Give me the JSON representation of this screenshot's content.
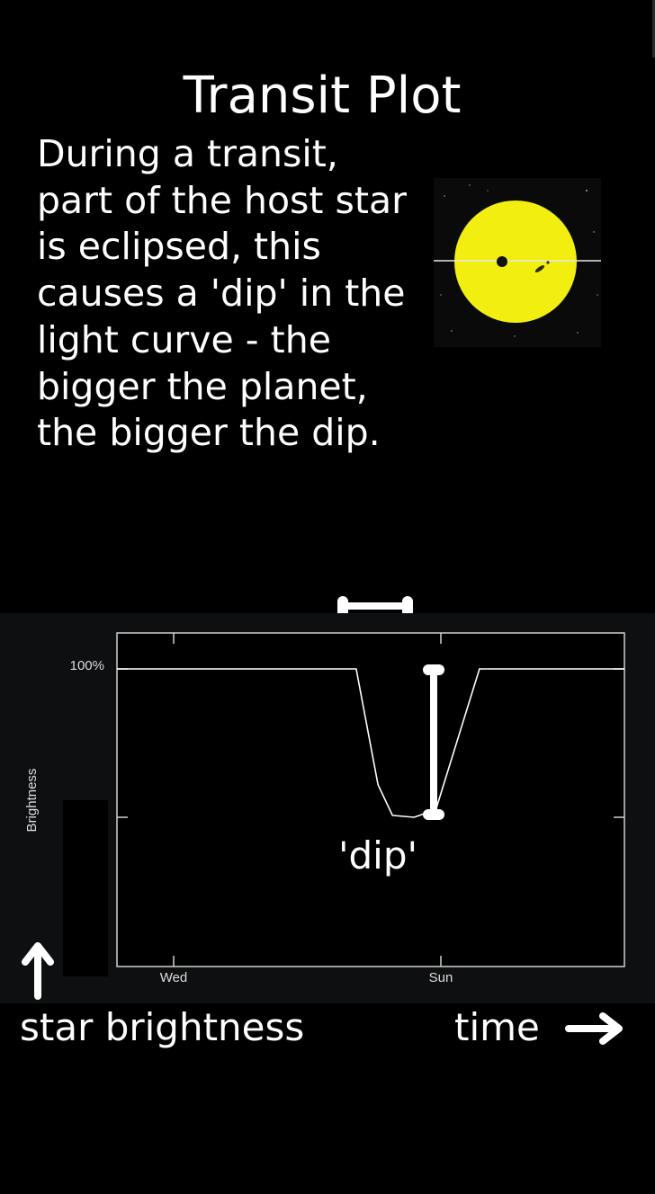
{
  "header": {
    "title": "Transit Plot"
  },
  "description": {
    "text": "During a transit, part of the host star is eclipsed, this causes a 'dip' in the light curve - the bigger the planet, the bigger the dip."
  },
  "transit_image": {
    "icon": "star-with-transiting-planet-icon",
    "star_color": "#f2ee10",
    "sky_color": "#0a0a0a"
  },
  "chart_data": {
    "type": "line",
    "title": "",
    "ylabel": "Brightness",
    "xlabel": "",
    "x_tick_labels": [
      "Wed",
      "Sun"
    ],
    "y_tick_labels": [
      "100%"
    ],
    "grid": false,
    "series": [
      {
        "x": [
          0,
          3.3,
          3.6,
          3.8,
          4.1,
          4.4,
          5.0,
          7.0
        ],
        "y": [
          100,
          100,
          94,
          92.4,
          92.3,
          92.7,
          100,
          100
        ],
        "color": "#ffffff"
      }
    ],
    "annotations": {
      "dip_label": "'dip'",
      "time_label": "time",
      "brightness_label": "star brightness"
    },
    "colors": {
      "plot_background": "#0e0f11",
      "plot_area": "#000000",
      "axis": "#cccccc",
      "marker": "#ffffff"
    }
  }
}
